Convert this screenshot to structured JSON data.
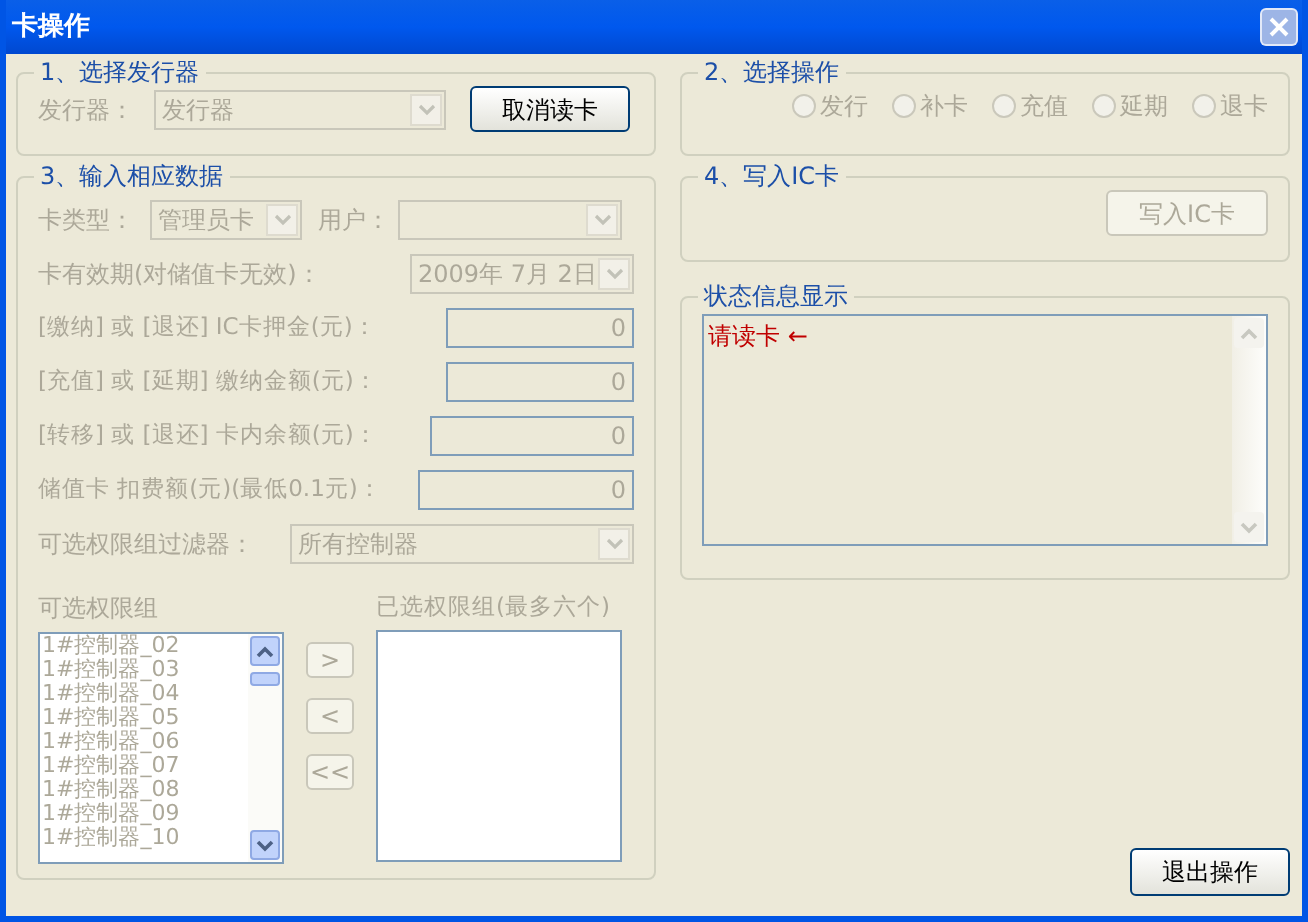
{
  "window": {
    "title": "卡操作"
  },
  "issuer_group": {
    "title": "1、选择发行器",
    "label": "发行器：",
    "select": {
      "value": "发行器",
      "disabled": true
    },
    "button": {
      "label": "取消读卡",
      "disabled": false
    }
  },
  "data_group": {
    "title": "3、输入相应数据",
    "card_type": {
      "label": "卡类型：",
      "value": "管理员卡",
      "disabled": true
    },
    "user": {
      "label": "用户：",
      "disabled": true
    },
    "expiry": {
      "label": "卡有效期(对储值卡无效)：",
      "value": "2009年 7月 2日",
      "disabled": true
    },
    "amount_fields": [
      {
        "label": "[缴纳] 或 [退还] IC卡押金(元)：",
        "value": "0",
        "disabled": true
      },
      {
        "label": "[充值] 或 [延期] 缴纳金额(元)：",
        "value": "0",
        "disabled": true
      },
      {
        "label": "[转移] 或 [退还] 卡内余额(元)：",
        "value": "0",
        "disabled": true
      },
      {
        "label": "储值卡 扣费额(元)(最低0.1元)：",
        "value": "0",
        "disabled": true
      }
    ],
    "filter": {
      "label": "可选权限组过滤器：",
      "value": "所有控制器",
      "disabled": true
    },
    "available_list": {
      "label": "可选权限组",
      "disabled": true,
      "items": [
        {
          "text": "1#控制器_02",
          "selected": false
        },
        {
          "text": "1#控制器_03",
          "selected": false
        },
        {
          "text": "1#控制器_04",
          "selected": false
        },
        {
          "text": "1#控制器_05",
          "selected": false
        },
        {
          "text": "1#控制器_06",
          "selected": false
        },
        {
          "text": "1#控制器_07",
          "selected": false
        },
        {
          "text": "1#控制器_08",
          "selected": false
        },
        {
          "text": "1#控制器_09",
          "selected": false
        },
        {
          "text": "1#控制器_10",
          "selected": false
        }
      ]
    },
    "move_buttons": [
      {
        "label": ">",
        "disabled": true
      },
      {
        "label": "<",
        "disabled": true
      },
      {
        "label": "<<",
        "disabled": true
      }
    ],
    "chosen_list": {
      "label": "已选权限组(最多六个)",
      "disabled": true
    }
  },
  "operation_group": {
    "title": "2、选择操作",
    "options": [
      {
        "label": "发行",
        "selected": false,
        "disabled": true
      },
      {
        "label": "补卡",
        "selected": false,
        "disabled": true
      },
      {
        "label": "充值",
        "selected": false,
        "disabled": true
      },
      {
        "label": "延期",
        "selected": false,
        "disabled": true
      },
      {
        "label": "退卡",
        "selected": false,
        "disabled": true
      }
    ]
  },
  "write_group": {
    "title": "4、写入IC卡",
    "button": {
      "label": "写入IC卡",
      "disabled": true
    }
  },
  "status_group": {
    "title": "状态信息显示",
    "message": "请读卡 ←"
  },
  "exit_button": {
    "label": "退出操作",
    "disabled": false
  }
}
